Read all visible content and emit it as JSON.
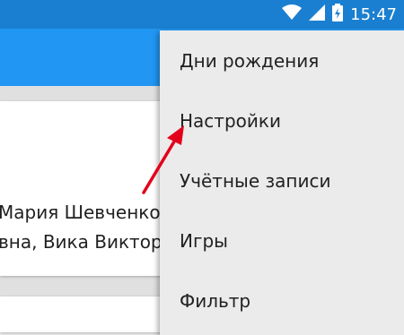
{
  "status_bar": {
    "time": "15:47",
    "icons": [
      "wifi-icon",
      "signal-icon",
      "battery-icon"
    ]
  },
  "colors": {
    "status_bar": "#1a7fd0",
    "app_bar": "#2196f3",
    "menu_background": "#ebebeb",
    "arrow": "#e3001b"
  },
  "card": {
    "line1": "Мария Шевченко",
    "line2": "вна, Вика Виктор"
  },
  "menu": {
    "items": [
      {
        "label": "Дни рождения"
      },
      {
        "label": "Настройки"
      },
      {
        "label": "Учётные записи"
      },
      {
        "label": "Игры"
      },
      {
        "label": "Фильтр"
      }
    ]
  }
}
